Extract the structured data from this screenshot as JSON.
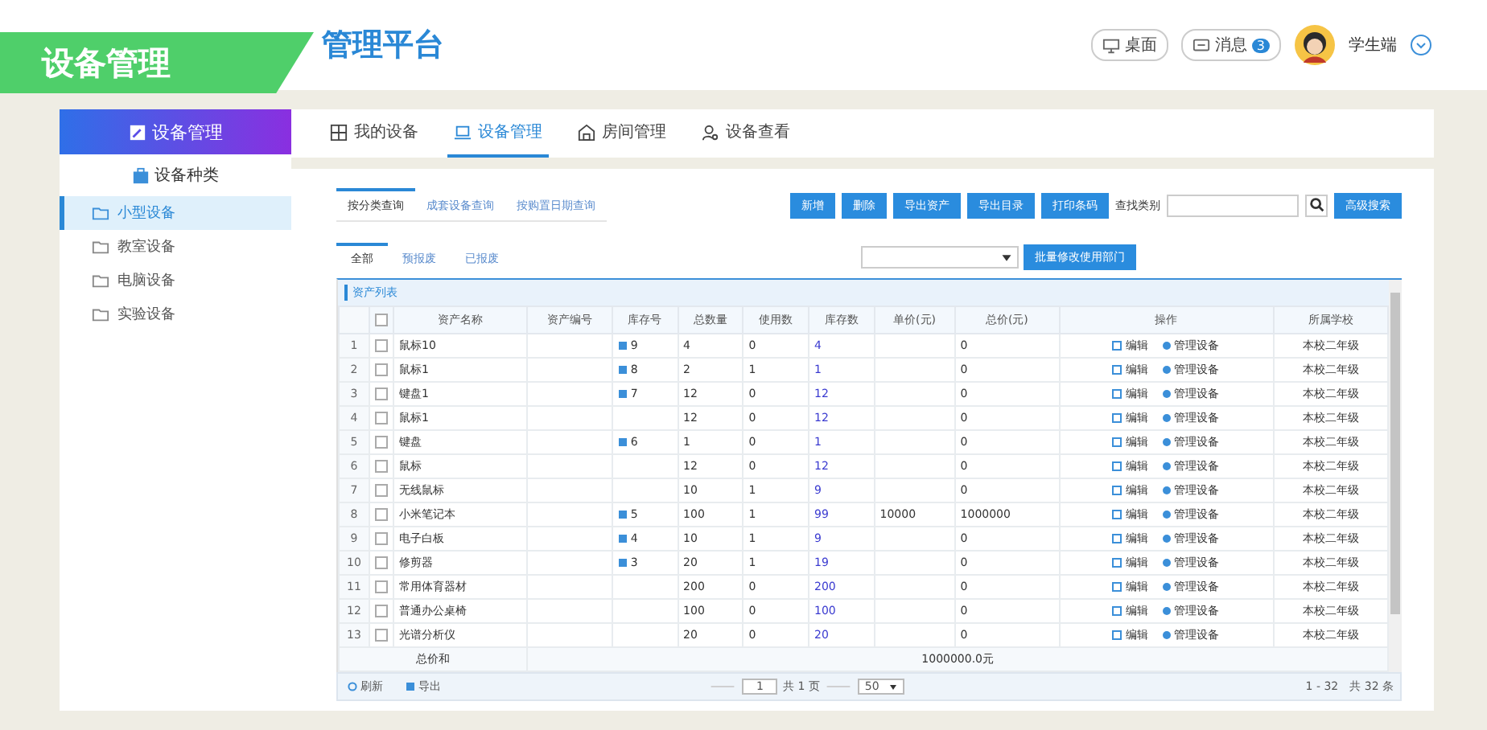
{
  "header": {
    "title": "管理平台",
    "desktop": "桌面",
    "messages": "消息",
    "message_count": "3",
    "user": "学生端"
  },
  "banner": "设备管理",
  "sidebar": {
    "title": "设备管理",
    "section": "设备种类",
    "items": [
      {
        "label": "小型设备",
        "selected": true
      },
      {
        "label": "教室设备",
        "selected": false
      },
      {
        "label": "电脑设备",
        "selected": false
      },
      {
        "label": "实验设备",
        "selected": false
      }
    ]
  },
  "nav_tabs": [
    {
      "label": "我的设备",
      "selected": false
    },
    {
      "label": "设备管理",
      "selected": true
    },
    {
      "label": "房间管理",
      "selected": false
    },
    {
      "label": "设备查看",
      "selected": false
    }
  ],
  "query_tabs": [
    {
      "label": "按分类查询",
      "selected": true
    },
    {
      "label": "成套设备查询",
      "selected": false
    },
    {
      "label": "按购置日期查询",
      "selected": false
    }
  ],
  "toolbar": {
    "buttons": [
      "新增",
      "删除",
      "导出资产",
      "导出目录",
      "打印条码"
    ],
    "search_label": "查找类别",
    "advanced": "高级搜索"
  },
  "status_tabs": [
    {
      "label": "全部",
      "selected": true
    },
    {
      "label": "预报废",
      "selected": false
    },
    {
      "label": "已报废",
      "selected": false
    }
  ],
  "batch_button": "批量修改使用部门",
  "table": {
    "title": "资产列表",
    "all_checked": false,
    "columns": [
      "资产名称",
      "资产编号",
      "库存号",
      "总数量",
      "使用数",
      "库存数",
      "单价(元)",
      "总价(元)",
      "操作",
      "所属学校"
    ],
    "rows": [
      {
        "no": "1",
        "checked": false,
        "name": "鼠标10",
        "stock_no": "9",
        "total": "4",
        "used": "0",
        "stock": "4",
        "amount": "0",
        "actions": [
          "编辑",
          "管理设备"
        ],
        "school": "本校二年级"
      },
      {
        "no": "2",
        "checked": false,
        "name": "鼠标1",
        "stock_no": "8",
        "total": "2",
        "used": "1",
        "stock": "1",
        "amount": "0",
        "actions": [
          "编辑",
          "管理设备"
        ],
        "school": "本校二年级"
      },
      {
        "no": "3",
        "checked": false,
        "name": "键盘1",
        "stock_no": "7",
        "total": "12",
        "used": "0",
        "stock": "12",
        "amount": "0",
        "actions": [
          "编辑",
          "管理设备"
        ],
        "school": "本校二年级"
      },
      {
        "no": "4",
        "checked": false,
        "name": "鼠标1",
        "total": "12",
        "used": "0",
        "stock": "12",
        "amount": "0",
        "actions": [
          "编辑",
          "管理设备"
        ],
        "school": "本校二年级"
      },
      {
        "no": "5",
        "checked": false,
        "name": "键盘",
        "stock_no": "6",
        "total": "1",
        "used": "0",
        "stock": "1",
        "amount": "0",
        "actions": [
          "编辑",
          "管理设备"
        ],
        "school": "本校二年级"
      },
      {
        "no": "6",
        "checked": false,
        "name": "鼠标",
        "total": "12",
        "used": "0",
        "stock": "12",
        "amount": "0",
        "actions": [
          "编辑",
          "管理设备"
        ],
        "school": "本校二年级"
      },
      {
        "no": "7",
        "checked": false,
        "name": "无线鼠标",
        "total": "10",
        "used": "1",
        "stock": "9",
        "amount": "0",
        "actions": [
          "编辑",
          "管理设备"
        ],
        "school": "本校二年级"
      },
      {
        "no": "8",
        "checked": false,
        "name": "小米笔记本",
        "stock_no": "5",
        "total": "100",
        "used": "1",
        "stock": "99",
        "price": "10000",
        "amount": "1000000",
        "actions": [
          "编辑",
          "管理设备"
        ],
        "school": "本校二年级"
      },
      {
        "no": "9",
        "checked": false,
        "name": "电子白板",
        "stock_no": "4",
        "total": "10",
        "used": "1",
        "stock": "9",
        "amount": "0",
        "actions": [
          "编辑",
          "管理设备"
        ],
        "school": "本校二年级"
      },
      {
        "no": "10",
        "checked": false,
        "name": "修剪器",
        "stock_no": "3",
        "total": "20",
        "used": "1",
        "stock": "19",
        "amount": "0",
        "actions": [
          "编辑",
          "管理设备"
        ],
        "school": "本校二年级"
      },
      {
        "no": "11",
        "checked": false,
        "name": "常用体育器材",
        "total": "200",
        "used": "0",
        "stock": "200",
        "amount": "0",
        "actions": [
          "编辑",
          "管理设备"
        ],
        "school": "本校二年级"
      },
      {
        "no": "12",
        "checked": false,
        "name": "普通办公桌椅",
        "total": "100",
        "used": "0",
        "stock": "100",
        "amount": "0",
        "actions": [
          "编辑",
          "管理设备"
        ],
        "school": "本校二年级"
      },
      {
        "no": "13",
        "checked": false,
        "name": "光谱分析仪",
        "total": "20",
        "used": "0",
        "stock": "20",
        "amount": "0",
        "actions": [
          "编辑",
          "管理设备"
        ],
        "school": "本校二年级"
      }
    ],
    "sum_label": "总价和",
    "sum_value": "1000000.0元"
  },
  "footer": {
    "refresh": "刷新",
    "export": "导出",
    "page": "1",
    "page_total": "共 1 页",
    "page_size": "50",
    "range": "1 - 32　共 32 条"
  }
}
